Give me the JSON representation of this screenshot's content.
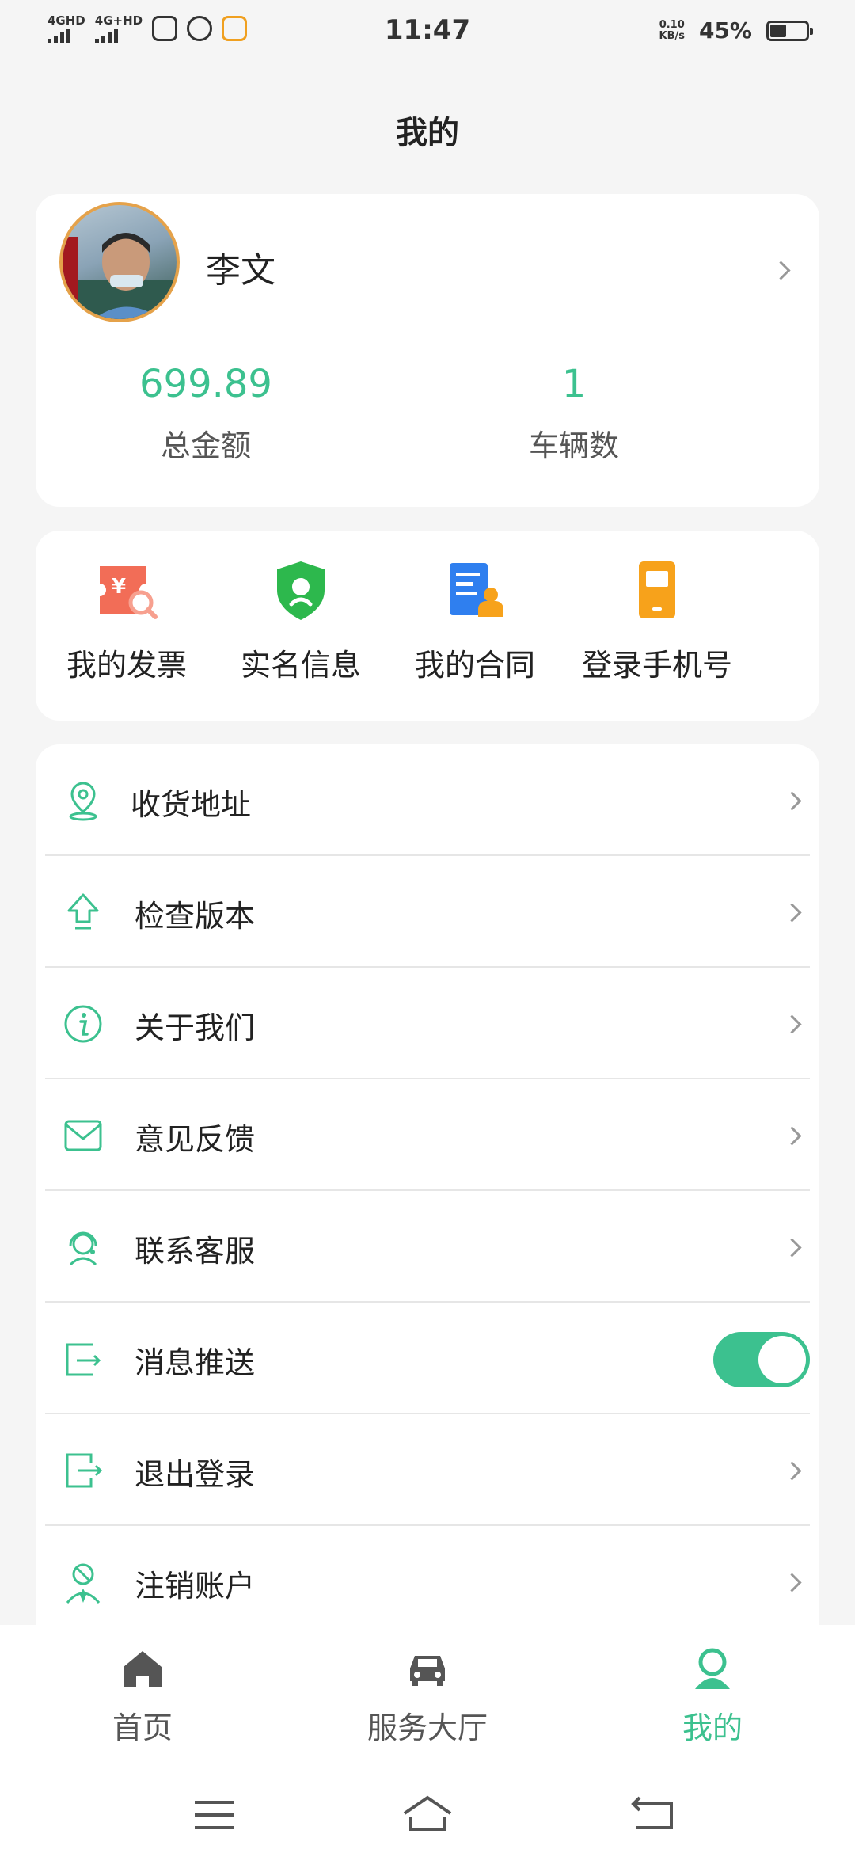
{
  "status_bar": {
    "signal_1": "4GHD",
    "signal_2": "4G+HD",
    "time": "11:47",
    "net_speed_value": "0.10",
    "net_speed_unit": "KB/s",
    "battery_percent": "45%",
    "battery_level": 0.45
  },
  "header": {
    "title": "我的"
  },
  "profile": {
    "name": "李文",
    "stats": [
      {
        "value": "699.89",
        "label": "总金额"
      },
      {
        "value": "1",
        "label": "车辆数"
      }
    ]
  },
  "shortcuts": [
    {
      "label": "我的发票",
      "icon": "invoice-icon",
      "color": "#f26d57"
    },
    {
      "label": "实名信息",
      "icon": "shield-icon",
      "color": "#2db84d"
    },
    {
      "label": "我的合同",
      "icon": "contract-icon",
      "color": "#2f7fef"
    },
    {
      "label": "登录手机号",
      "icon": "phone-icon",
      "color": "#f7a21b"
    }
  ],
  "menu": [
    {
      "label": "收货地址",
      "icon": "location-pin-icon"
    },
    {
      "label": "检查版本",
      "icon": "upload-arrow-icon"
    },
    {
      "label": "关于我们",
      "icon": "info-icon"
    },
    {
      "label": "意见反馈",
      "icon": "mail-icon"
    },
    {
      "label": "联系客服",
      "icon": "customer-service-icon"
    },
    {
      "label": "消息推送",
      "icon": "push-message-icon",
      "toggle": true
    },
    {
      "label": "退出登录",
      "icon": "logout-icon"
    },
    {
      "label": "注销账户",
      "icon": "cancel-account-icon"
    }
  ],
  "tabs": [
    {
      "label": "首页",
      "icon": "home-icon",
      "active": false
    },
    {
      "label": "服务大厅",
      "icon": "car-icon",
      "active": false
    },
    {
      "label": "我的",
      "icon": "user-icon",
      "active": true
    }
  ],
  "colors": {
    "accent": "#3cc18f",
    "inactive": "#555555",
    "background": "#f5f5f5"
  }
}
